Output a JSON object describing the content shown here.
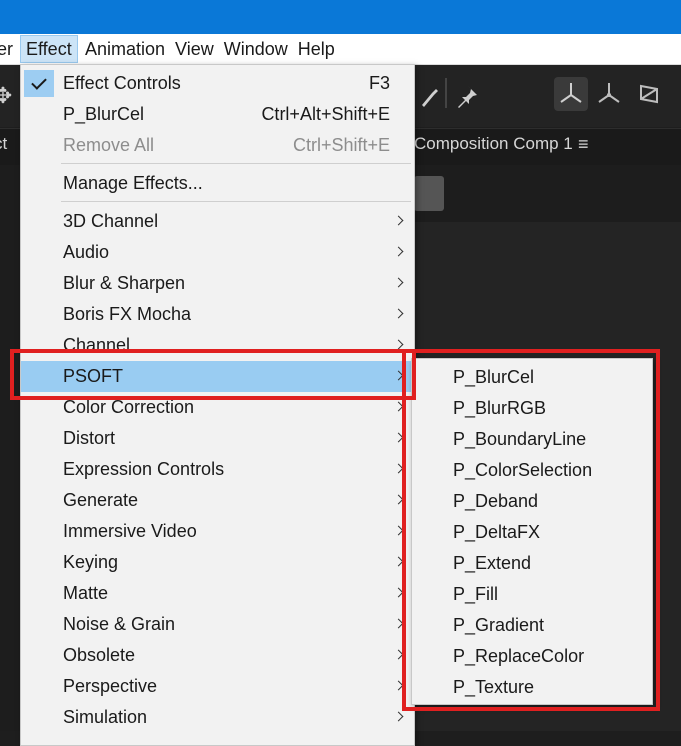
{
  "menubar": {
    "partial_item": "er",
    "items": [
      {
        "label": "Effect"
      },
      {
        "label": "Animation"
      },
      {
        "label": "View"
      },
      {
        "label": "Window"
      },
      {
        "label": "Help"
      }
    ]
  },
  "panel": {
    "left_tab_partial": "ct",
    "composition_title": "Composition Comp 1",
    "menu_glyph": "≡"
  },
  "effect_menu": {
    "items": [
      {
        "label": "Effect Controls",
        "shortcut": "F3",
        "checked": true
      },
      {
        "label": "P_BlurCel",
        "shortcut": "Ctrl+Alt+Shift+E"
      },
      {
        "label": "Remove All",
        "shortcut": "Ctrl+Shift+E",
        "disabled": true
      },
      {
        "label": "Manage Effects..."
      },
      {
        "label": "3D Channel",
        "submenu": true
      },
      {
        "label": "Audio",
        "submenu": true
      },
      {
        "label": "Blur & Sharpen",
        "submenu": true
      },
      {
        "label": "Boris FX Mocha",
        "submenu": true
      },
      {
        "label": "Channel",
        "submenu": true
      },
      {
        "label": "PSOFT",
        "submenu": true,
        "highlighted": true
      },
      {
        "label": "Color Correction",
        "submenu": true
      },
      {
        "label": "Distort",
        "submenu": true
      },
      {
        "label": "Expression Controls",
        "submenu": true
      },
      {
        "label": "Generate",
        "submenu": true
      },
      {
        "label": "Immersive Video",
        "submenu": true
      },
      {
        "label": "Keying",
        "submenu": true
      },
      {
        "label": "Matte",
        "submenu": true
      },
      {
        "label": "Noise & Grain",
        "submenu": true
      },
      {
        "label": "Obsolete",
        "submenu": true
      },
      {
        "label": "Perspective",
        "submenu": true
      },
      {
        "label": "Simulation",
        "submenu": true
      }
    ]
  },
  "psoft_submenu": {
    "items": [
      {
        "label": "P_BlurCel"
      },
      {
        "label": "P_BlurRGB"
      },
      {
        "label": "P_BoundaryLine"
      },
      {
        "label": "P_ColorSelection"
      },
      {
        "label": "P_Deband"
      },
      {
        "label": "P_DeltaFX"
      },
      {
        "label": "P_Extend"
      },
      {
        "label": "P_Fill"
      },
      {
        "label": "P_Gradient"
      },
      {
        "label": "P_ReplaceColor"
      },
      {
        "label": "P_Texture"
      }
    ]
  },
  "colors": {
    "titlebar": "#0a78d7",
    "menu_bg": "#f2f2f2",
    "highlight": "#99ccf2",
    "annotation_red": "#e02020"
  }
}
